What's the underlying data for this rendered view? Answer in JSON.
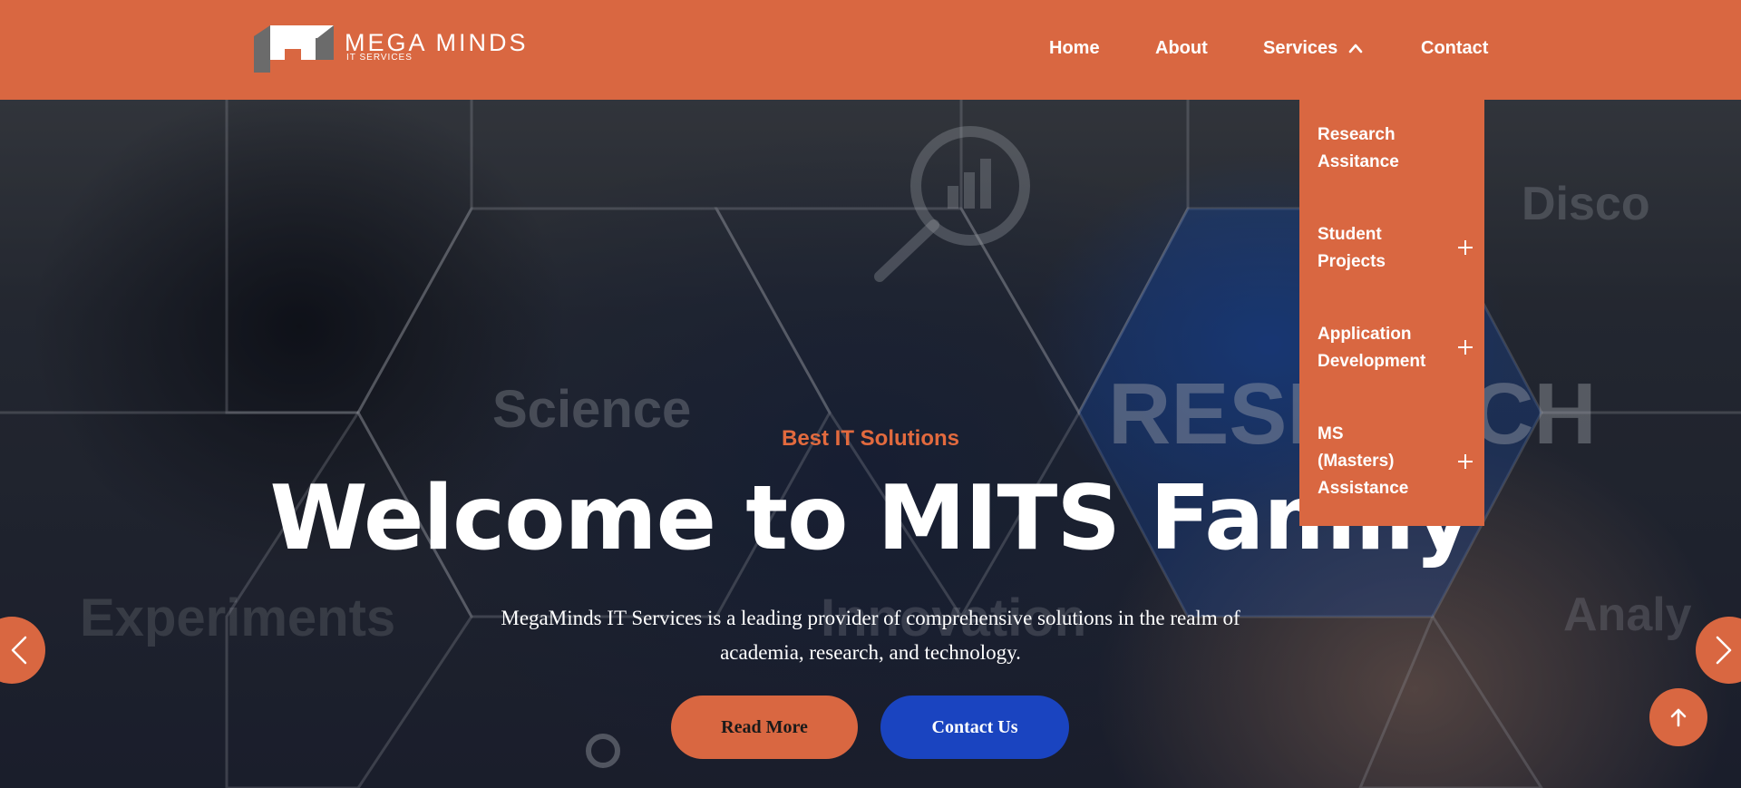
{
  "header": {
    "logo_title": "MEGA MINDS",
    "logo_subtitle": "IT SERVICES",
    "nav": {
      "home": "Home",
      "about": "About",
      "services": "Services",
      "contact": "Contact"
    }
  },
  "services_menu": {
    "items": [
      {
        "label": "Research\nAssitance",
        "has_submenu": false
      },
      {
        "label": "Student\nProjects",
        "has_submenu": true
      },
      {
        "label": "Application\nDevelopment",
        "has_submenu": true
      },
      {
        "label": "MS\n(Masters)\nAssistance",
        "has_submenu": true
      }
    ]
  },
  "hero": {
    "eyebrow": "Best IT Solutions",
    "title": "Welcome to MITS Family",
    "description": "MegaMinds IT Services is a leading provider of comprehensive solutions in the realm of academia, research, and technology.",
    "read_more": "Read More",
    "contact_us": "Contact Us",
    "background_words": {
      "science": "Science",
      "experiments": "Experiments",
      "innovation": "Innovation",
      "research": "RESEARCH",
      "discover": "Disco",
      "analysis": "Analy"
    }
  },
  "controls": {
    "prev_icon": "chevron-left-icon",
    "next_icon": "chevron-right-icon",
    "top_icon": "arrow-up-icon"
  },
  "colors": {
    "brand": "#d96741",
    "accent_blue": "#1a44c0",
    "eyebrow": "#e26a3e"
  }
}
